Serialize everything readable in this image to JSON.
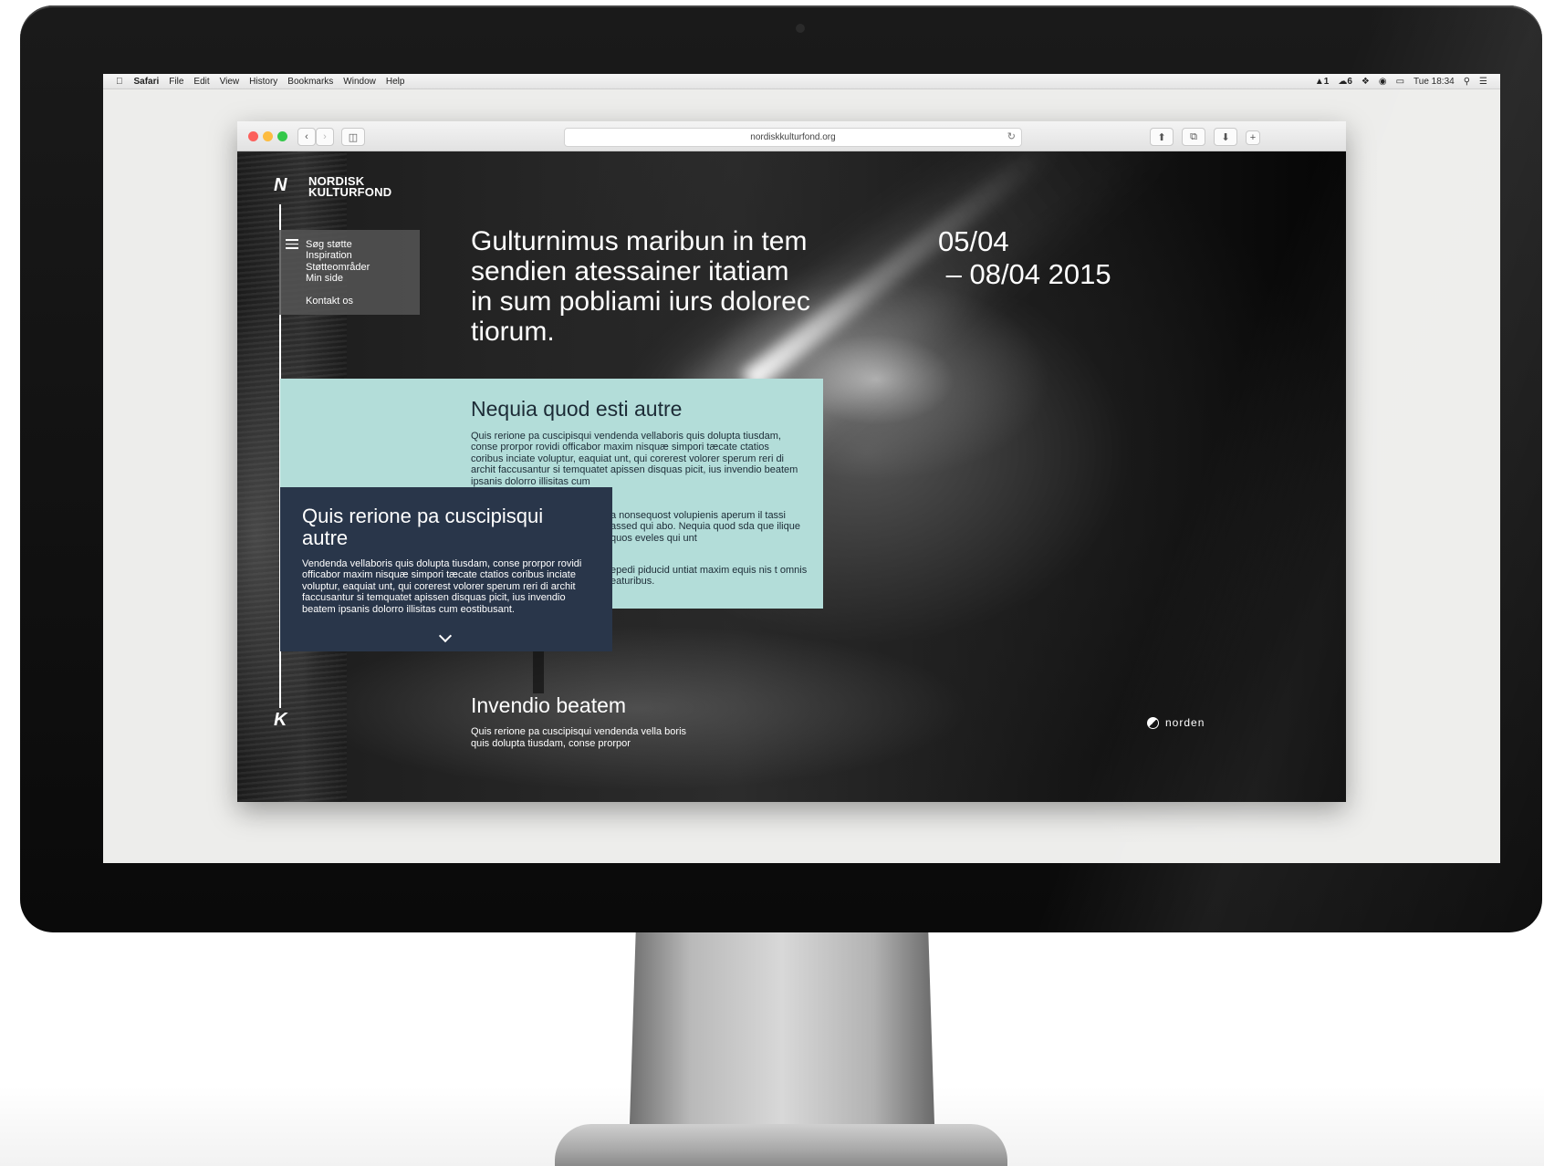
{
  "menubar": {
    "apple_icon": "apple-icon",
    "items": [
      "Safari",
      "File",
      "Edit",
      "View",
      "History",
      "Bookmarks",
      "Window",
      "Help"
    ],
    "status_app_count": "1",
    "status_icon_count": "6",
    "clock": "Tue 18:34"
  },
  "browser": {
    "url": "nordiskkulturfond.org"
  },
  "site": {
    "logo_lines": [
      "NORDISK",
      "KULTURFOND"
    ],
    "nav_items": [
      "Søg støtte",
      "Inspiration",
      "Støtteområder",
      "Min side"
    ],
    "nav_contact": "Kontakt os",
    "hero_title": "Gulturnimus maribun in tem sendien atessainer itatiam in sum pobliami iurs dolorec tiorum.",
    "hero_date_line1": "05/04",
    "hero_date_line2": " – 08/04 2015",
    "card_mint": {
      "title": "Nequia quod esti autre",
      "p1": "Quis rerione pa cuscipisqui vendenda vellaboris quis dolupta tiusdam, conse prorpor rovidi officabor maxim nisquæ simpori tæcate ctatios coribus inciate voluptur, eaquiat unt, qui corerest volorer sperum reri di archit faccusantur si temquatet apissen disquas picit, ius invendio beatem ipsanis dolorro illisitas cum",
      "p2": "a nonsequost volupienis aperum il tassi assed qui abo. Nequia quod sda que ilique quos eveles qui unt",
      "p3": "epedi piducid untiat maxim equis nis t omnis eaturibus."
    },
    "card_navy": {
      "title": "Quis rerione pa cuscipisqui autre",
      "body": "Vendenda vellaboris quis dolupta tiusdam, conse prorpor rovidi officabor maxim nisquæ simpori tæcate ctatios coribus inciate voluptur, eaquiat unt, qui corerest volorer sperum reri di archit faccusantur si temquatet apissen disquas picit, ius invendio beatem ipsanis dolorro illisitas cum eostibusant."
    },
    "section": {
      "title": "Invendio beatem",
      "body": "Quis rerione pa cuscipisqui vendenda vella boris quis dolupta tiusdam, conse prorpor"
    },
    "partner_logo": "norden"
  },
  "colors": {
    "mint": "#b3ddd9",
    "navy": "#29364a",
    "nav_panel": "#555555"
  }
}
